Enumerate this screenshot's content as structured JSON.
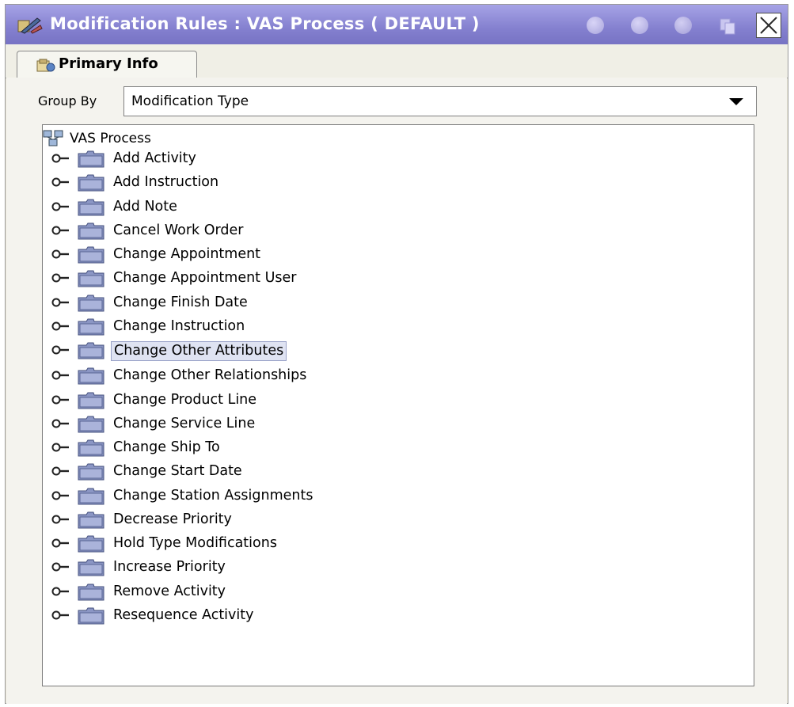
{
  "window": {
    "title": "Modification Rules : VAS Process ( DEFAULT )",
    "icons": [
      "modification-rules-icon",
      "check-icon",
      "cancel-icon",
      "circle-icon",
      "copy-icon",
      "close-icon"
    ]
  },
  "tabs": [
    {
      "label": "Primary Info",
      "icon": "primary-info-icon",
      "selected": true
    }
  ],
  "group_by": {
    "label": "Group By",
    "value": "Modification Type"
  },
  "tree": {
    "root": {
      "label": "VAS Process",
      "icon": "process-icon"
    },
    "nodes": [
      {
        "label": "Add Activity"
      },
      {
        "label": "Add Instruction"
      },
      {
        "label": "Add Note"
      },
      {
        "label": "Cancel Work Order"
      },
      {
        "label": "Change Appointment"
      },
      {
        "label": "Change Appointment User"
      },
      {
        "label": "Change Finish Date"
      },
      {
        "label": "Change Instruction"
      },
      {
        "label": "Change Other Attributes",
        "selected": true
      },
      {
        "label": "Change Other Relationships"
      },
      {
        "label": "Change Product Line"
      },
      {
        "label": "Change Service Line"
      },
      {
        "label": "Change Ship To"
      },
      {
        "label": "Change Start Date"
      },
      {
        "label": "Change Station Assignments"
      },
      {
        "label": "Decrease Priority"
      },
      {
        "label": "Hold Type Modifications"
      },
      {
        "label": "Increase Priority"
      },
      {
        "label": "Remove Activity"
      },
      {
        "label": "Resequence Activity"
      }
    ]
  },
  "colors": {
    "titlebar": "#8480cf",
    "selection": "#dfe3f2",
    "folder": "#8b96c4"
  }
}
